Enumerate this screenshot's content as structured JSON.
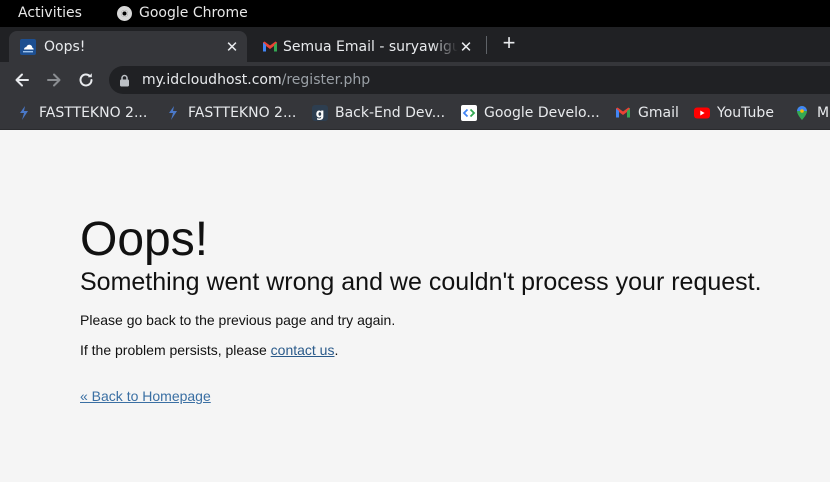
{
  "system_bar": {
    "activities_label": "Activities",
    "app_name": "Google Chrome"
  },
  "tabs": [
    {
      "title": "Oops!",
      "favicon": "idcloudhost-icon",
      "active": true
    },
    {
      "title": "Semua Email - suryawigunaaa",
      "favicon": "gmail-icon",
      "active": false
    }
  ],
  "toolbar": {
    "url_host": "my.idcloudhost.com",
    "url_path": "/register.php"
  },
  "bookmarks": [
    {
      "label": "FASTTEKNO 2...",
      "icon": "fasttekno-icon"
    },
    {
      "label": "FASTTEKNO 2...",
      "icon": "fasttekno-icon"
    },
    {
      "label": "Back-End Dev...",
      "icon": "dicoding-icon"
    },
    {
      "label": "Google Develo...",
      "icon": "google-developers-icon"
    },
    {
      "label": "Gmail",
      "icon": "gmail-icon"
    },
    {
      "label": "YouTube",
      "icon": "youtube-icon"
    },
    {
      "label": "Maps",
      "icon": "maps-icon"
    }
  ],
  "page": {
    "heading": "Oops!",
    "subheading": "Something went wrong and we couldn't process your request.",
    "line1": "Please go back to the previous page and try again.",
    "line2_prefix": "If the problem persists, please ",
    "line2_link": "contact us",
    "line2_suffix": ".",
    "back_link": "« Back to Homepage"
  },
  "colors": {
    "tab_strip": "#202124",
    "toolbar": "#35363a",
    "page_background": "#f5f5f5",
    "link": "#3a6fa3"
  }
}
